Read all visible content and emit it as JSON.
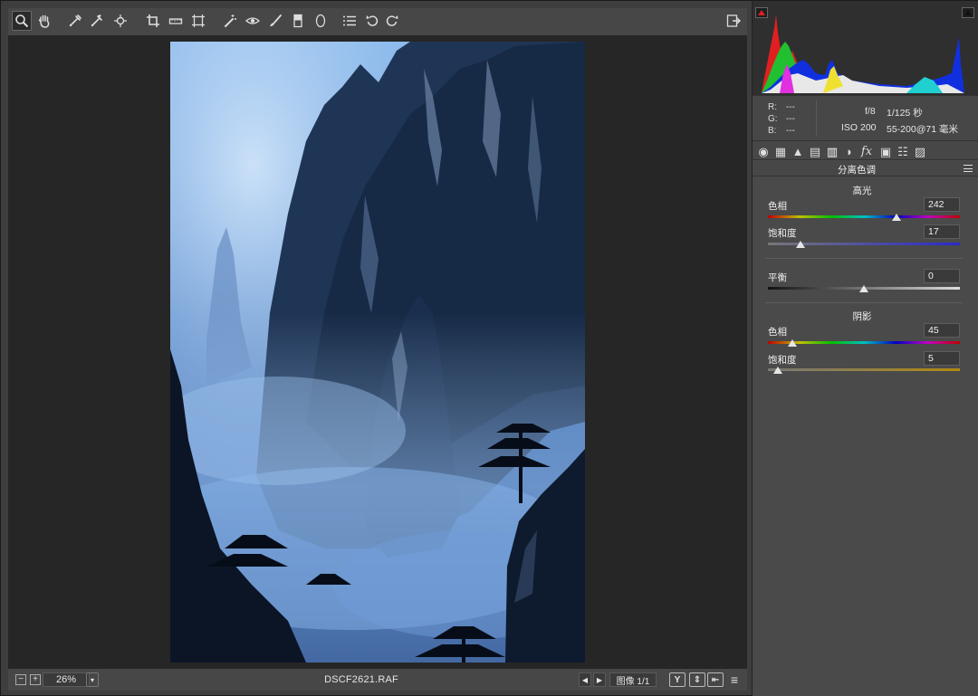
{
  "toolbar": {
    "tools": [
      {
        "name": "zoom-tool",
        "glyph": "🔍"
      },
      {
        "name": "hand-tool",
        "glyph": "✋"
      },
      {
        "name": "white-balance-tool",
        "glyph": "✎"
      },
      {
        "name": "color-sampler-tool",
        "glyph": "✎"
      },
      {
        "name": "targeted-adjustment-tool",
        "glyph": "◎"
      },
      {
        "name": "crop-tool",
        "glyph": "⌗"
      },
      {
        "name": "straighten-tool",
        "glyph": "▭"
      },
      {
        "name": "transform-tool",
        "glyph": "⊞"
      },
      {
        "name": "spot-removal-tool",
        "glyph": "✂"
      },
      {
        "name": "red-eye-tool",
        "glyph": "◉"
      },
      {
        "name": "adjustment-brush-tool",
        "glyph": "╱"
      },
      {
        "name": "graduated-filter-tool",
        "glyph": "▮"
      },
      {
        "name": "radial-filter-tool",
        "glyph": "◯"
      },
      {
        "name": "preferences-tool",
        "glyph": "☰"
      },
      {
        "name": "rotate-left-tool",
        "glyph": "↺"
      },
      {
        "name": "rotate-right-tool",
        "glyph": "↻"
      }
    ],
    "export_glyph": "⇥"
  },
  "bottom_bar": {
    "zoom_out": "−",
    "zoom_in": "+",
    "zoom_level": "26%",
    "zoom_dropdown": "▾",
    "filename": "DSCF2621.RAF",
    "prev": "◀",
    "next": "▶",
    "image_count": "图像 1/1",
    "before_after_y": "Y",
    "swap": "⇕",
    "copy": "⇤",
    "settings": "≡"
  },
  "info": {
    "r_label": "R:",
    "r_value": "---",
    "g_label": "G:",
    "g_value": "---",
    "b_label": "B:",
    "b_value": "---",
    "aperture": "f/8",
    "shutter": "1/125 秒",
    "iso": "ISO 200",
    "lens": "55-200@71 毫米"
  },
  "panel_tabs": [
    "◉",
    "▦",
    "▲",
    "▤",
    "▥",
    "◗",
    "fx",
    "▣",
    "☷",
    "▨"
  ],
  "panel": {
    "title": "分离色调",
    "highlights": {
      "title": "高光",
      "hue_label": "色相",
      "hue_value": "242",
      "hue_fraction": 0.672,
      "saturation_label": "饱和度",
      "saturation_value": "17",
      "saturation_fraction": 0.17
    },
    "balance": {
      "label": "平衡",
      "value": "0",
      "fraction": 0.5
    },
    "shadows": {
      "title": "阴影",
      "hue_label": "色相",
      "hue_value": "45",
      "hue_fraction": 0.125,
      "saturation_label": "饱和度",
      "saturation_value": "5",
      "saturation_fraction": 0.05
    }
  },
  "colors": {
    "accent_red": "#e02020",
    "track_gray": "#888888"
  }
}
